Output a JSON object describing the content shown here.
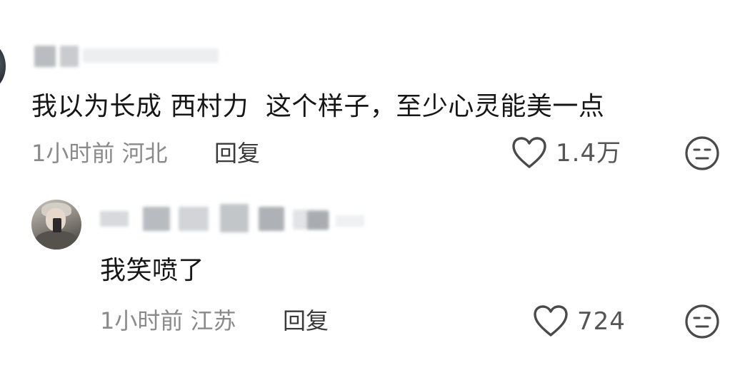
{
  "colors": {
    "text_primary": "#161616",
    "text_meta": "#8a8a8a",
    "icon_stroke": "#4a4a4a"
  },
  "comments": [
    {
      "username": "",
      "text": "我以为长成 西村力  这个样子，至少心灵能美一点",
      "time": "1小时前",
      "location": "河北",
      "reply_label": "回复",
      "like_count": "1.4万",
      "like_icon": "heart-outline-icon",
      "dislike_icon": "neutral-face-icon",
      "replies": [
        {
          "username": "",
          "text": "我笑喷了",
          "time": "1小时前",
          "location": "江苏",
          "reply_label": "回复",
          "like_count": "724",
          "like_icon": "heart-outline-icon",
          "dislike_icon": "neutral-face-icon"
        }
      ]
    }
  ]
}
